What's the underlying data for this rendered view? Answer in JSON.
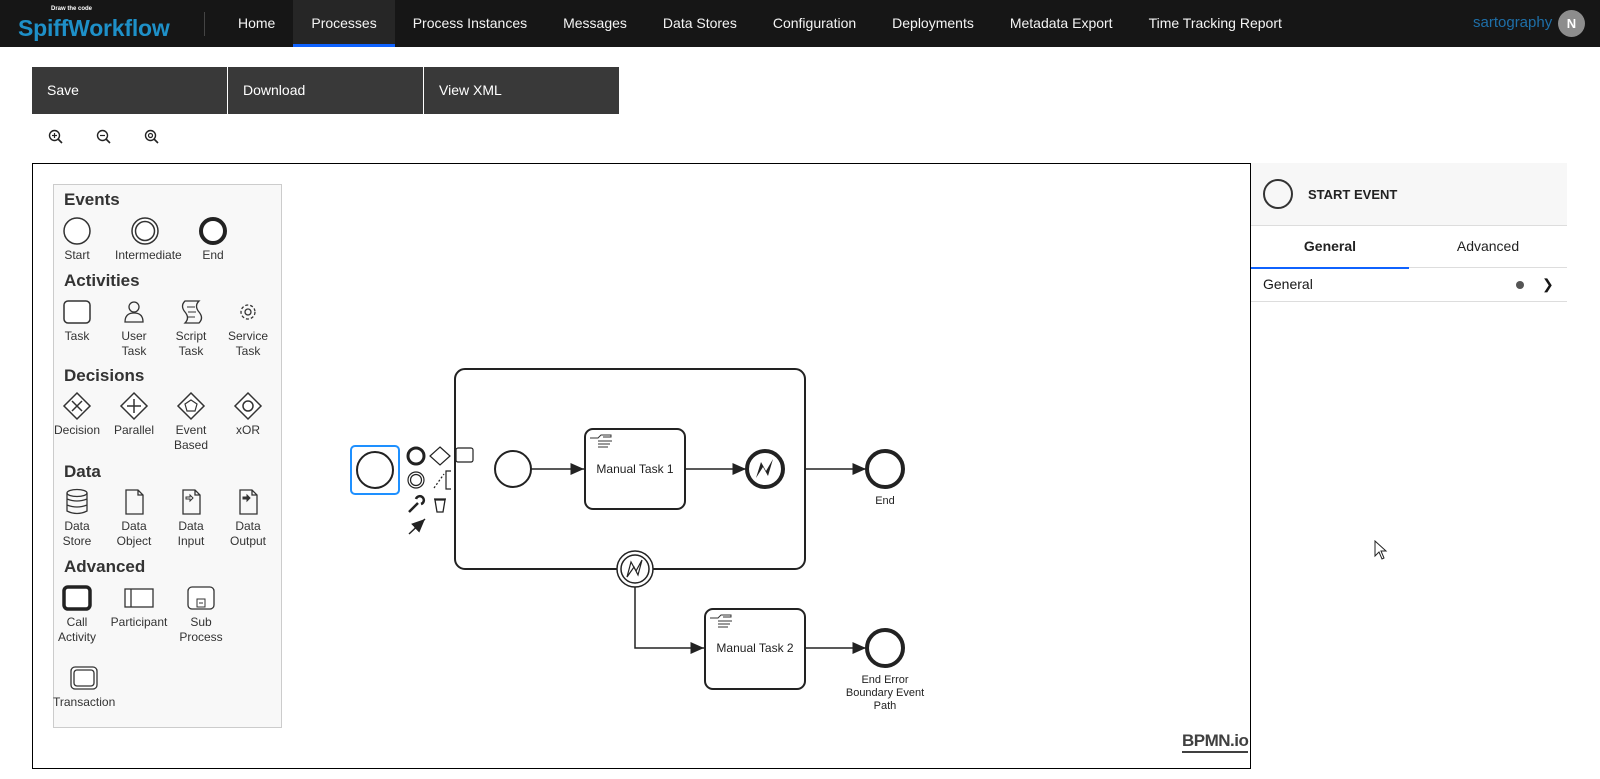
{
  "brand": {
    "tagline": "Draw the code",
    "name": "SpiffWorkflow"
  },
  "nav": {
    "items": [
      "Home",
      "Processes",
      "Process Instances",
      "Messages",
      "Data Stores",
      "Configuration",
      "Deployments",
      "Metadata Export",
      "Time Tracking Report"
    ],
    "active": "Processes"
  },
  "user": {
    "name": "sartography",
    "initial": "N"
  },
  "toolbar": {
    "save": "Save",
    "download": "Download",
    "view_xml": "View XML"
  },
  "zoom_icons": [
    "zoom-in-icon",
    "zoom-out-icon",
    "zoom-reset-icon"
  ],
  "palette": {
    "events": {
      "heading": "Events",
      "start": "Start",
      "intermediate": "Intermediate",
      "end": "End"
    },
    "activities": {
      "heading": "Activities",
      "task": "Task",
      "user_task_1": "User",
      "user_task_2": "Task",
      "script_task_1": "Script",
      "script_task_2": "Task",
      "service_task_1": "Service",
      "service_task_2": "Task"
    },
    "decisions": {
      "heading": "Decisions",
      "decision": "Decision",
      "parallel": "Parallel",
      "event_based_1": "Event",
      "event_based_2": "Based",
      "xor": "xOR"
    },
    "data": {
      "heading": "Data",
      "data_store_1": "Data",
      "data_store_2": "Store",
      "data_object_1": "Data",
      "data_object_2": "Object",
      "data_input_1": "Data",
      "data_input_2": "Input",
      "data_output_1": "Data",
      "data_output_2": "Output"
    },
    "advanced": {
      "heading": "Advanced",
      "call_activity_1": "Call",
      "call_activity_2": "Activity",
      "participant": "Participant",
      "sub_process_1": "Sub",
      "sub_process_2": "Process",
      "transaction": "Transaction"
    }
  },
  "diagram": {
    "task1": "Manual Task 1",
    "task2": "Manual Task 2",
    "end": "End",
    "end_error_1": "End Error",
    "end_error_2": "Boundary Event",
    "end_error_3": "Path"
  },
  "watermark": "BPMN.io",
  "properties": {
    "title": "START EVENT",
    "tabs": [
      "General",
      "Advanced"
    ],
    "active_tab": "General",
    "group": "General"
  },
  "colors": {
    "nav_bg": "#161616",
    "active_underline": "#0f62fe",
    "selection": "#1e90ff"
  }
}
